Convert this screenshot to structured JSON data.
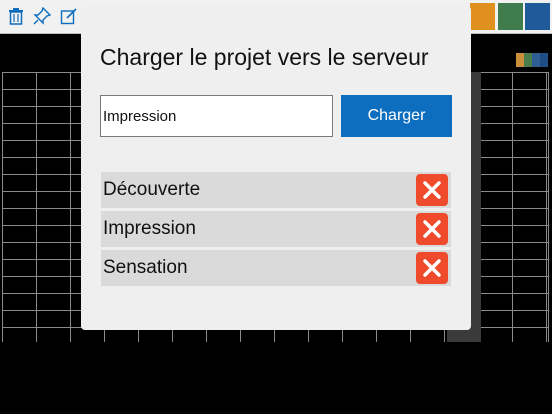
{
  "toolbar": {
    "icons": [
      "trash-icon",
      "pin-icon",
      "edit-icon"
    ],
    "swatches": [
      "#e0901f",
      "#3f7c4e",
      "#1f5a9b"
    ]
  },
  "grid": {
    "cell_line_color": "#8a8a8a"
  },
  "mini_swatches": [
    "#c98f3b",
    "#4a7d4e",
    "#2e5e92",
    "#1f4f84"
  ],
  "modal": {
    "title": "Charger le projet vers le serveur",
    "input": {
      "value": "Impression",
      "placeholder": ""
    },
    "load_button_label": "Charger",
    "projects": [
      {
        "name": "Découverte"
      },
      {
        "name": "Impression"
      },
      {
        "name": "Sensation"
      }
    ],
    "delete_icon": "close-x-icon",
    "accent_color": "#0d6ebf",
    "delete_color": "#f04a2c"
  }
}
